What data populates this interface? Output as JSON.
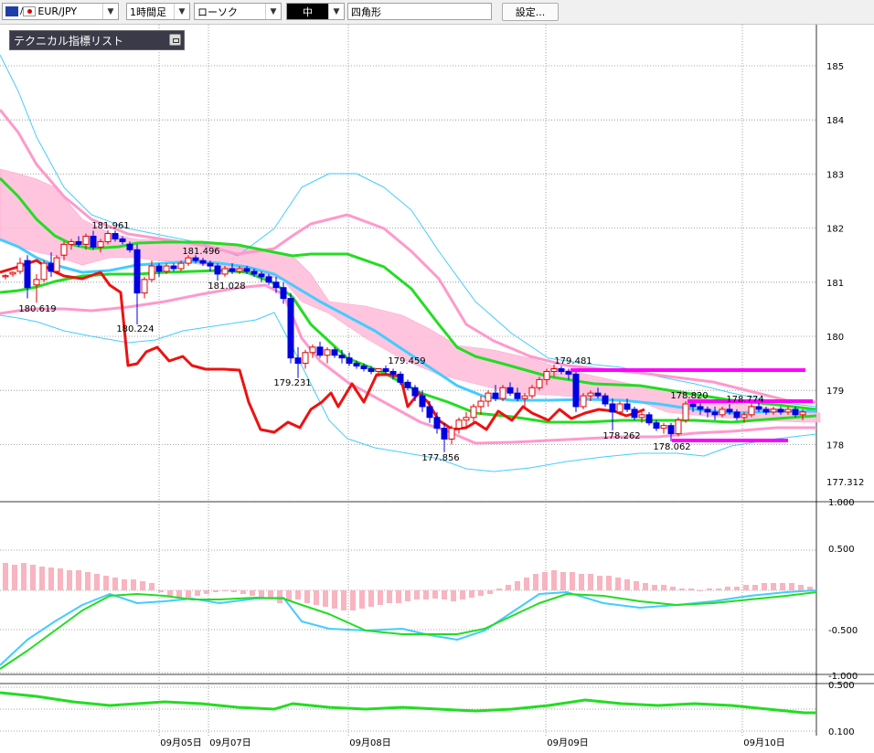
{
  "toolbar": {
    "pair": "EUR/JPY",
    "timeframe": "1時間足",
    "chart_type": "ローソク",
    "line_width": "中",
    "shape": "四角形",
    "settings_button": "設定..."
  },
  "tech_list": {
    "label": "テクニカル指標リスト"
  },
  "colors": {
    "bull": "#e00000",
    "bear": "#0000e0",
    "ma_green": "#22dd22",
    "ma_cyan": "#44ccff",
    "bb_pink": "#ff99cc",
    "cloud": "#ffbfdc",
    "tenkan_red": "#ee1111",
    "magenta_line": "#ff00ff"
  },
  "chart_data": [
    {
      "type": "candlestick",
      "title": "",
      "ylim": [
        177.312,
        185.5
      ],
      "y_ticks": [
        "185",
        "184",
        "183",
        "182",
        "181",
        "180",
        "179",
        "178",
        "177.312"
      ],
      "x_ticks": [
        "09月05日",
        "09月07日",
        "09月08日",
        "09月09日",
        "09月10日"
      ],
      "annotations": [
        "181.961",
        "180.619",
        "181.496",
        "180.224",
        "181.028",
        "179.231",
        "179.459",
        "177.856",
        "179.481",
        "178.262",
        "178.820",
        "178.062",
        "178.774"
      ]
    },
    {
      "type": "bar",
      "title": "",
      "y_ticks": [
        "1.000",
        "0.500",
        "-0.500",
        "-1.000"
      ],
      "ylim": [
        -1.0,
        1.0
      ]
    },
    {
      "type": "line",
      "title": "",
      "y_ticks": [
        "0.500",
        "0.100"
      ]
    }
  ]
}
